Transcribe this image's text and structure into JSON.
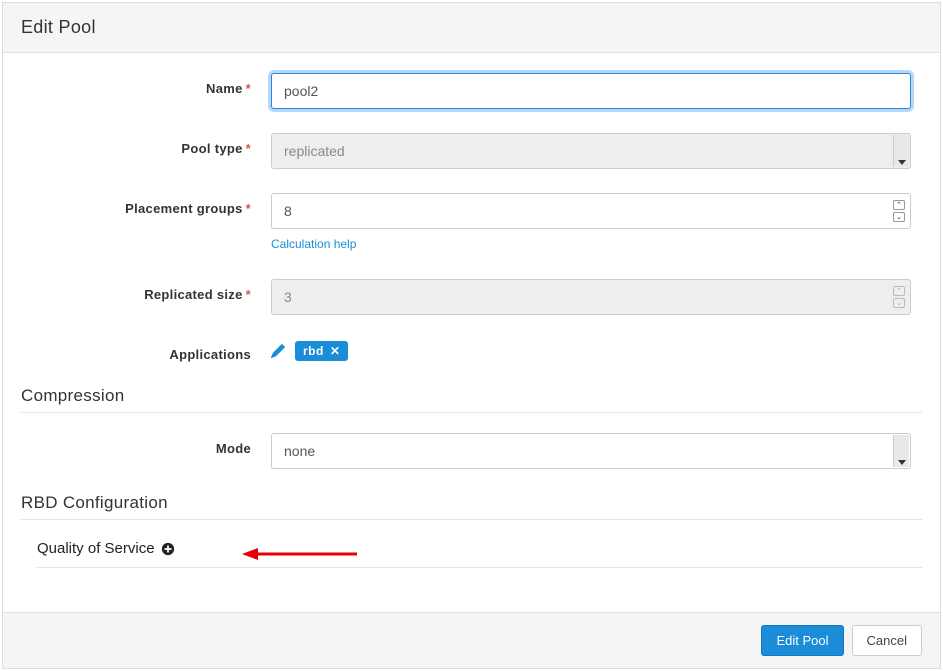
{
  "header": {
    "title": "Edit Pool"
  },
  "form": {
    "name": {
      "label": "Name",
      "required": true,
      "value": "pool2"
    },
    "pool_type": {
      "label": "Pool type",
      "required": true,
      "value": "replicated"
    },
    "pg": {
      "label": "Placement groups",
      "required": true,
      "value": "8",
      "help": "Calculation help"
    },
    "replicated_size": {
      "label": "Replicated size",
      "required": true,
      "value": "3"
    },
    "applications": {
      "label": "Applications",
      "tags": [
        "rbd"
      ]
    }
  },
  "compression": {
    "title": "Compression",
    "mode": {
      "label": "Mode",
      "value": "none"
    }
  },
  "rbd": {
    "title": "RBD Configuration",
    "qos": {
      "label": "Quality of Service"
    }
  },
  "footer": {
    "submit": "Edit Pool",
    "cancel": "Cancel"
  }
}
